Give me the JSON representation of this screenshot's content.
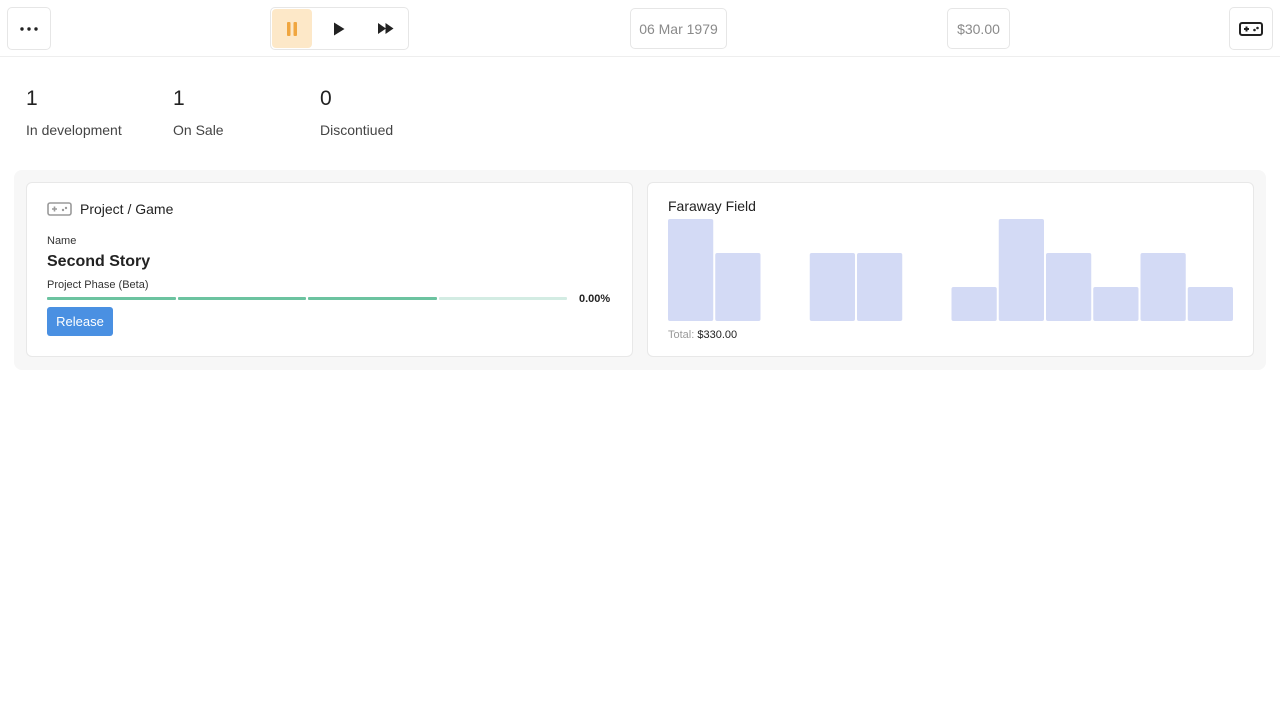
{
  "topbar": {
    "menu_icon": "ellipsis-icon",
    "speed_controls": [
      {
        "icon": "pause-icon",
        "active": true
      },
      {
        "icon": "play-icon",
        "active": false
      },
      {
        "icon": "fast-forward-icon",
        "active": false
      }
    ],
    "date": "06 Mar 1979",
    "money": "$30.00",
    "games_icon": "gamepad-icon"
  },
  "stats": [
    {
      "value": "1",
      "label": "In development"
    },
    {
      "value": "1",
      "label": "On Sale"
    },
    {
      "value": "0",
      "label": "Discontiued"
    }
  ],
  "project_card": {
    "icon": "gamepad-icon",
    "title": "Project / Game",
    "name_label": "Name",
    "name": "Second Story",
    "phase_label": "Project Phase (Beta)",
    "phase_segments_total": 4,
    "phase_segments_complete": 3,
    "progress": "0.00%",
    "release_label": "Release"
  },
  "sales_card": {
    "title": "Faraway Field",
    "total_label": "Total:",
    "total_value": "$330.00",
    "chart_data": {
      "type": "bar",
      "values": [
        30,
        20,
        0,
        20,
        20,
        0,
        10,
        30,
        20,
        10,
        20,
        10
      ],
      "ylim": [
        0,
        30
      ],
      "bar_color": "#d3daf5"
    }
  },
  "colors": {
    "accent_button": "#4a90e2",
    "progress_done": "#6cc3a0",
    "progress_pending": "#d3ece3",
    "active_speed_bg": "#fde8c8",
    "pause_icon": "#f0a640"
  }
}
